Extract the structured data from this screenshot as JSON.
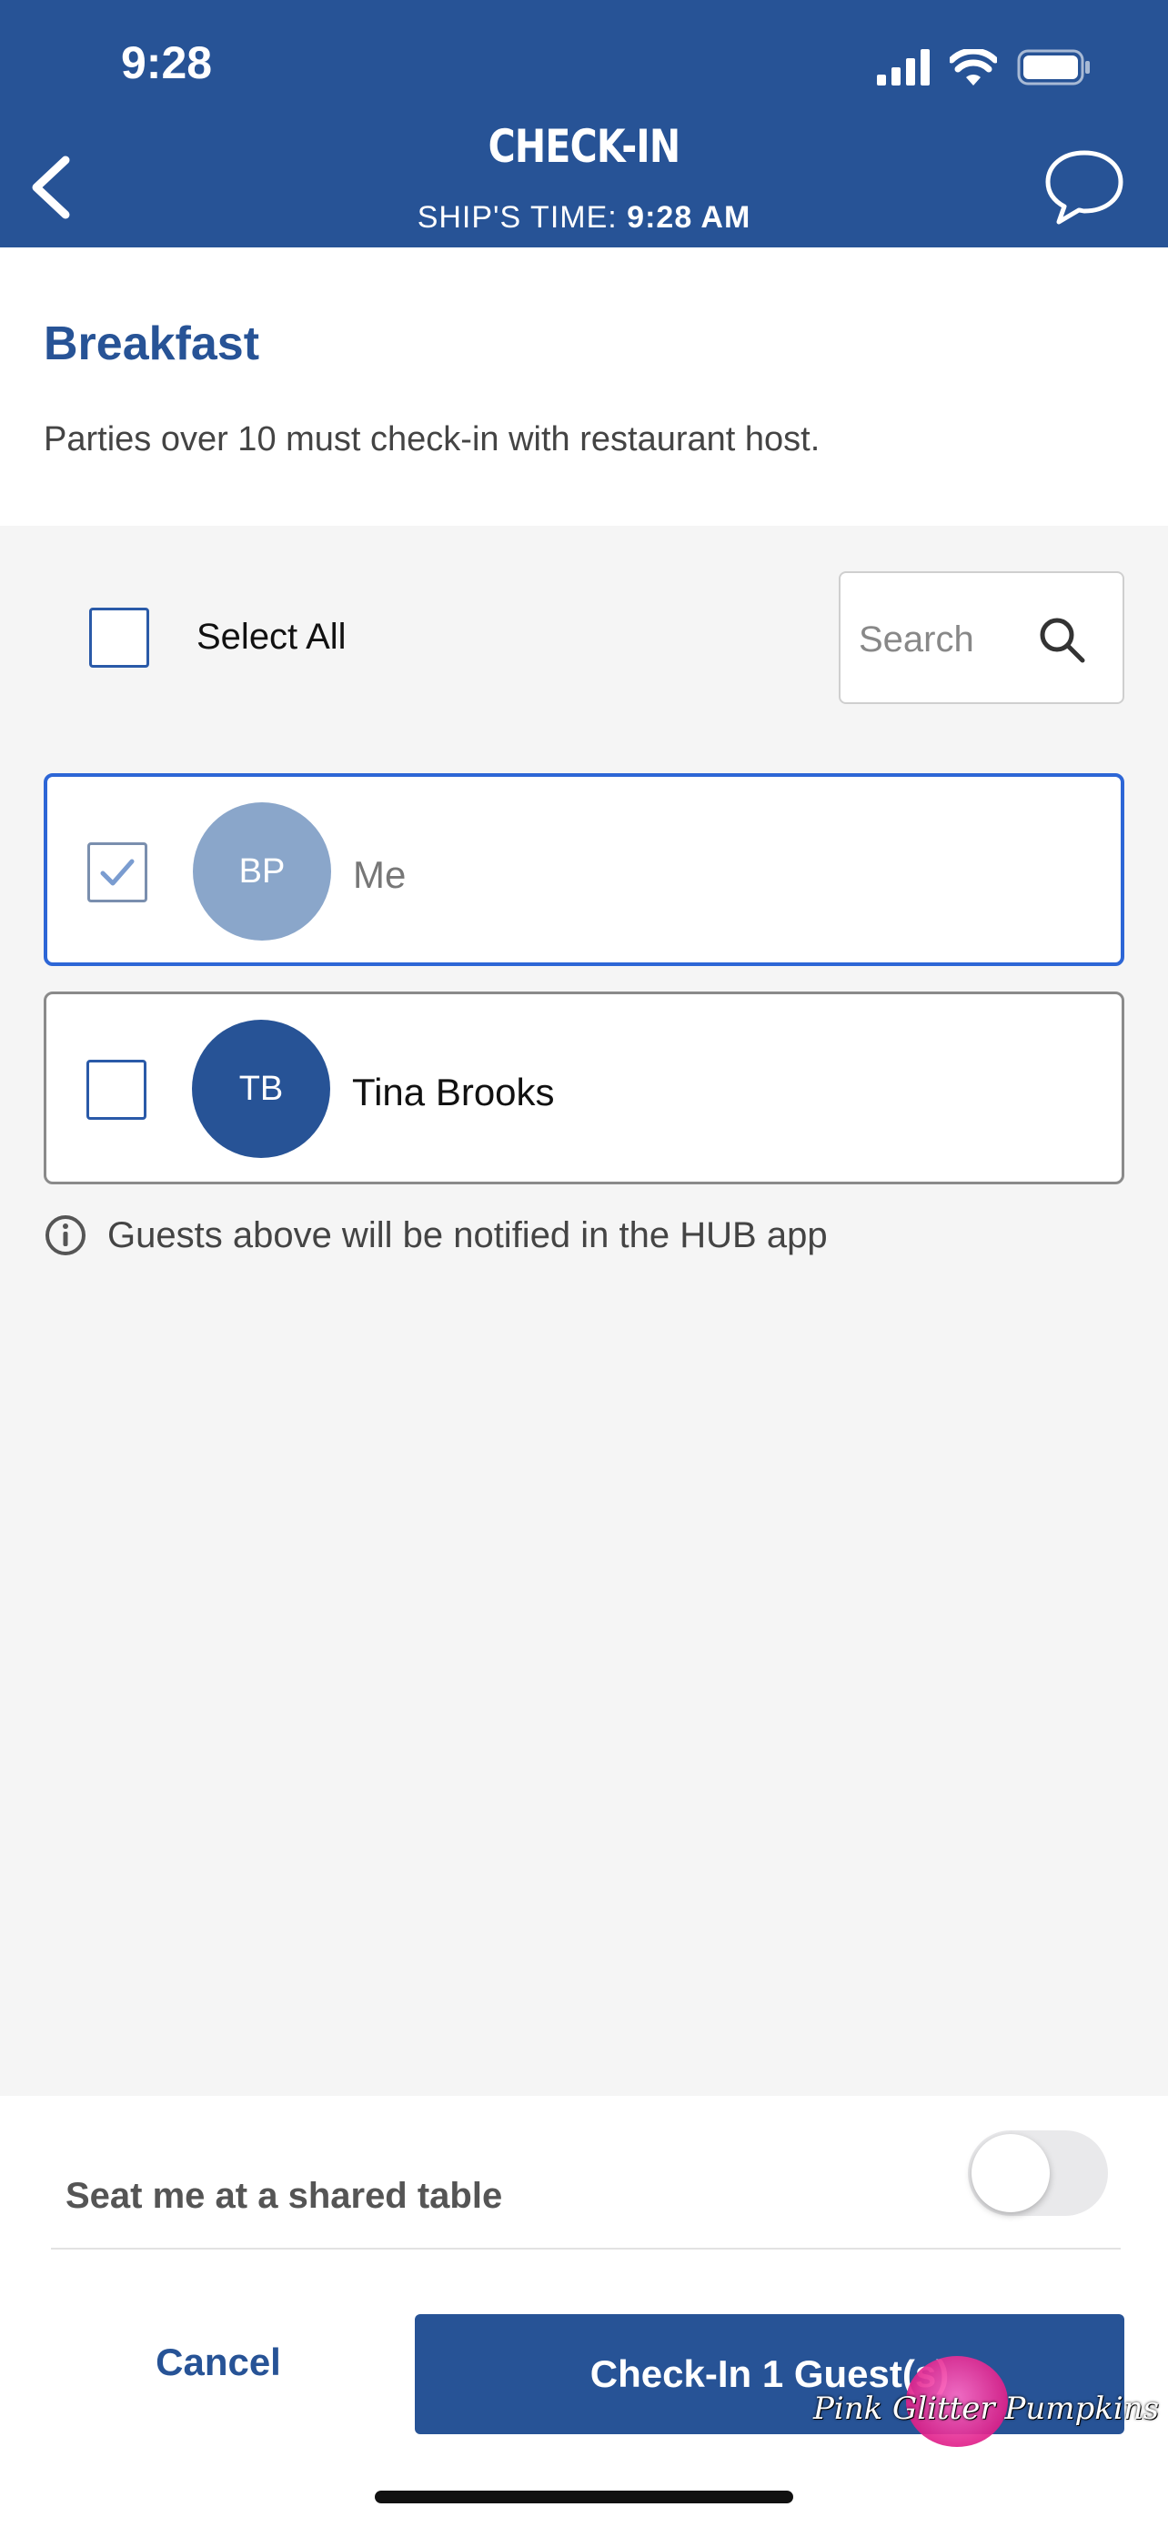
{
  "status_bar": {
    "time": "9:28"
  },
  "header": {
    "title": "CHECK-IN",
    "ships_time_label": "SHIP'S TIME:",
    "ships_time_value": "9:28 AM"
  },
  "meal": {
    "title": "Breakfast",
    "note": "Parties over 10 must check-in with restaurant host."
  },
  "select_all": {
    "label": "Select All",
    "checked": false
  },
  "search": {
    "placeholder": "Search"
  },
  "guests": [
    {
      "initials": "BP",
      "name": "Me",
      "checked": true,
      "avatar_color": "#8aa6ca",
      "name_color": "#777777"
    },
    {
      "initials": "TB",
      "name": "Tina Brooks",
      "checked": false,
      "avatar_color": "#275396",
      "name_color": "#111111"
    }
  ],
  "notice": "Guests above will be notified in the HUB app",
  "shared_table": {
    "label": "Seat me at a shared table",
    "enabled": false
  },
  "actions": {
    "cancel_label": "Cancel",
    "checkin_label": "Check-In 1 Guest(s)"
  },
  "watermark": "Pink Glitter Pumpkins",
  "colors": {
    "brand": "#275396",
    "selected_border": "#2d66d6",
    "background": "#f5f5f5"
  },
  "icons": [
    "back-chevron-icon",
    "chat-bubble-icon",
    "search-icon",
    "info-icon",
    "checkmark-icon",
    "signal-icon",
    "wifi-icon",
    "battery-icon"
  ]
}
